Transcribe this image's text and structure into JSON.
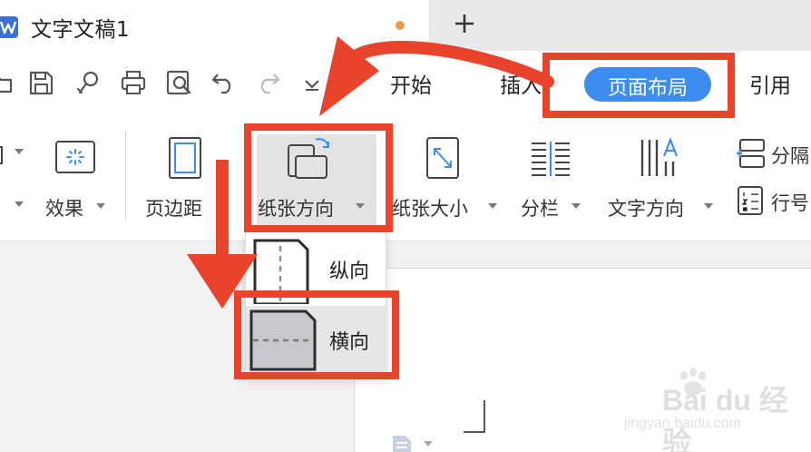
{
  "tab": {
    "title": "文字文稿1",
    "new_tab": "+"
  },
  "menu": {
    "items": [
      "开始",
      "插入",
      "页面布局",
      "引用"
    ],
    "active": "页面布局"
  },
  "ribbon": {
    "effect_label": "效果",
    "margin_label": "页边距",
    "orientation_label": "纸张方向",
    "size_label": "纸张大小",
    "columns_label": "分栏",
    "text_direction_label": "文字方向",
    "breaks_label": "分隔",
    "line_numbers_label": "行号"
  },
  "dropdown": {
    "portrait": "纵向",
    "landscape": "横向"
  },
  "watermark": {
    "brand": "Bai du 经验",
    "url": "jingyan.baidu.com"
  },
  "colors": {
    "accent": "#3d8cf0",
    "annotation": "#e8432c",
    "unsaved": "#e99c50"
  }
}
